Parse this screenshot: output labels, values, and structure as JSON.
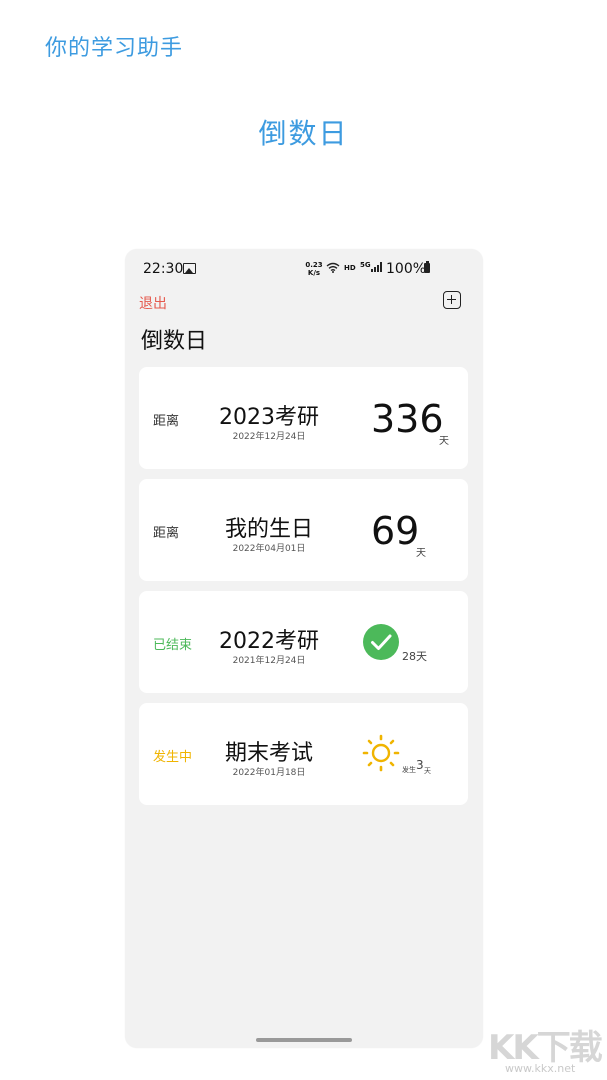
{
  "promo": {
    "header": "你的学习助手",
    "title": "倒数日"
  },
  "status_bar": {
    "time": "22:30",
    "net_speed_value": "0.23",
    "net_speed_unit": "K/s",
    "hd": "HD",
    "network": "5G",
    "battery": "100%"
  },
  "app": {
    "exit_label": "退出",
    "title": "倒数日",
    "add_icon": "plus-square-icon"
  },
  "events": [
    {
      "status": "距离",
      "name": "2023考研",
      "date": "2022年12月24日",
      "count": "336",
      "unit": "天"
    },
    {
      "status": "距离",
      "name": "我的生日",
      "date": "2022年04月01日",
      "count": "69",
      "unit": "天"
    },
    {
      "status": "已结束",
      "name": "2022考研",
      "date": "2021年12月24日",
      "ended_text": "28天",
      "icon": "check-circle-icon"
    },
    {
      "status": "发生中",
      "name": "期末考试",
      "date": "2022年01月18日",
      "prefix": "发生",
      "count": "3",
      "unit": "天",
      "icon": "sun-icon"
    }
  ],
  "colors": {
    "accent": "#3d9be0",
    "exit": "#e55a4e",
    "ended": "#4cb95a",
    "ongoing": "#f0b400"
  },
  "watermark": {
    "logo": "KK下载",
    "url": "www.kkx.net"
  }
}
